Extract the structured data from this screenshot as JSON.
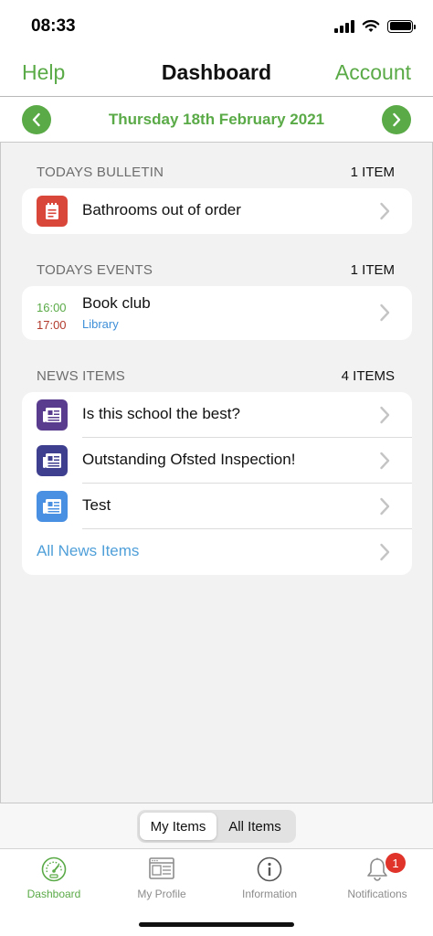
{
  "status_bar": {
    "time": "08:33"
  },
  "nav": {
    "left": "Help",
    "title": "Dashboard",
    "right": "Account"
  },
  "date_bar": {
    "date": "Thursday 18th February 2021"
  },
  "bulletin": {
    "title": "TODAYS BULLETIN",
    "count": "1 ITEM",
    "items": [
      {
        "label": "Bathrooms out of order",
        "icon": "notepad-icon",
        "color": "#d9473b"
      }
    ]
  },
  "events": {
    "title": "TODAYS EVENTS",
    "count": "1 ITEM",
    "items": [
      {
        "start": "16:00",
        "end": "17:00",
        "title": "Book club",
        "location": "Library"
      }
    ]
  },
  "news": {
    "title": "NEWS ITEMS",
    "count": "4 ITEMS",
    "items": [
      {
        "label": "Is this school the best?",
        "icon": "newspaper-icon",
        "color": "#5a3c8f"
      },
      {
        "label": "Outstanding Ofsted Inspection!",
        "icon": "newspaper-icon",
        "color": "#3f3f8f"
      },
      {
        "label": "Test",
        "icon": "newspaper-icon",
        "color": "#4a90e2"
      }
    ],
    "all_label": "All News Items"
  },
  "segment": {
    "options": [
      "My Items",
      "All Items"
    ],
    "selected": "My Items"
  },
  "tabs": [
    {
      "label": "Dashboard",
      "icon": "speedometer-icon",
      "active": true
    },
    {
      "label": "My Profile",
      "icon": "profile-card-icon",
      "active": false
    },
    {
      "label": "Information",
      "icon": "info-icon",
      "active": false
    },
    {
      "label": "Notifications",
      "icon": "bell-icon",
      "active": false,
      "badge": "1"
    }
  ],
  "colors": {
    "accent": "#5aaa47",
    "link": "#4f9fd9",
    "badge": "#e0332a"
  }
}
